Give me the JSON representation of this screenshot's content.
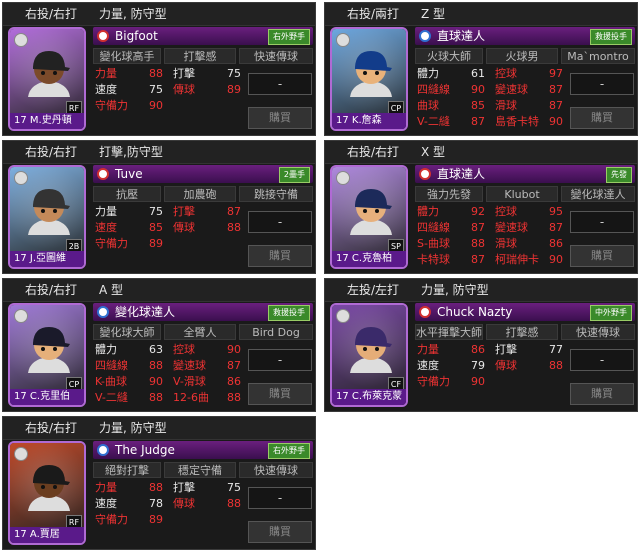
{
  "colors": {
    "stat_red": "#ee3333",
    "stat_white": "#e8e8e8",
    "skill_bar": "#6a1f7e",
    "portrait_border": "#b06ad4"
  },
  "cards": [
    {
      "hand": "右投/右打",
      "ptype": "力量, 防守型",
      "skill_icon": "red-circle-skill-icon",
      "skill_name": "Bigfoot",
      "role": "右外野手",
      "traits": [
        "變化球高手",
        "打擊感",
        "快速傳球"
      ],
      "stats": [
        [
          "力量",
          "88",
          "打擊",
          "75"
        ],
        [
          "速度",
          "75",
          "傳球",
          "89"
        ],
        [
          "守備力",
          "90",
          "",
          ""
        ]
      ],
      "stat_colors": [
        [
          "red",
          "red",
          "white",
          "white"
        ],
        [
          "white",
          "white",
          "red",
          "red"
        ],
        [
          "red",
          "red",
          "",
          ""
        ]
      ],
      "number_name": "17 M.史丹頓",
      "position": "RF",
      "select": "-",
      "buy": "購買",
      "portrait_color": "#b26edb",
      "cap": "#222",
      "face": "#7b4a2a"
    },
    {
      "hand": "右投/兩打",
      "ptype": "Z 型",
      "skill_icon": "blue-circle-skill-icon",
      "skill_name": "直球達人",
      "role": "救援投手",
      "traits": [
        "火球大師",
        "火球男",
        "Ma`montro"
      ],
      "stats": [
        [
          "體力",
          "61",
          "控球",
          "97"
        ],
        [
          "四縫線",
          "90",
          "變速球",
          "87"
        ],
        [
          "曲球",
          "85",
          "滑球",
          "87"
        ],
        [
          "V-二縫",
          "87",
          "島香卡特",
          "90"
        ]
      ],
      "stat_colors": [
        [
          "white",
          "white",
          "red",
          "red"
        ],
        [
          "red",
          "red",
          "red",
          "red"
        ],
        [
          "red",
          "red",
          "red",
          "red"
        ],
        [
          "red",
          "red",
          "red",
          "red"
        ]
      ],
      "number_name": "17 K.詹森",
      "position": "CP",
      "select": "-",
      "buy": "購買",
      "portrait_color": "#6ea8e0",
      "cap": "#123c8a",
      "face": "#e9b27a"
    },
    {
      "hand": "右投/右打",
      "ptype": "打擊,防守型",
      "skill_icon": "red-circle-skill-icon",
      "skill_name": "Tuve",
      "role": "2壘手",
      "traits": [
        "抗壓",
        "加農砲",
        "跳接守備"
      ],
      "stats": [
        [
          "力量",
          "75",
          "打擊",
          "87"
        ],
        [
          "速度",
          "85",
          "傳球",
          "88"
        ],
        [
          "守備力",
          "89",
          "",
          ""
        ]
      ],
      "stat_colors": [
        [
          "white",
          "white",
          "red",
          "red"
        ],
        [
          "red",
          "red",
          "red",
          "red"
        ],
        [
          "red",
          "red",
          "",
          ""
        ]
      ],
      "number_name": "17 J.亞圖維",
      "position": "2B",
      "select": "-",
      "buy": "購買",
      "portrait_color": "#7fb0e0",
      "cap": "#333",
      "face": "#c48a5a"
    },
    {
      "hand": "右投/右打",
      "ptype": "X 型",
      "skill_icon": "red-circle-skill-icon",
      "skill_name": "直球達人",
      "role": "先發",
      "traits": [
        "強力先發",
        "Klubot",
        "變化球達人"
      ],
      "stats": [
        [
          "體力",
          "92",
          "控球",
          "95"
        ],
        [
          "四縫線",
          "87",
          "變速球",
          "87"
        ],
        [
          "S-曲球",
          "88",
          "滑球",
          "86"
        ],
        [
          "卡特球",
          "87",
          "柯瑞伸卡",
          "90"
        ]
      ],
      "stat_colors": [
        [
          "red",
          "red",
          "red",
          "red"
        ],
        [
          "red",
          "red",
          "red",
          "red"
        ],
        [
          "red",
          "red",
          "red",
          "red"
        ],
        [
          "red",
          "red",
          "red",
          "red"
        ]
      ],
      "number_name": "17 C.克魯柏",
      "position": "SP",
      "select": "-",
      "buy": "購買",
      "portrait_color": "#b08adf",
      "cap": "#1c2a5a",
      "face": "#e7b07c"
    },
    {
      "hand": "右投/右打",
      "ptype": "A 型",
      "skill_icon": "blue-circle-skill-icon",
      "skill_name": "變化球達人",
      "role": "救援投手",
      "traits": [
        "變化球大師",
        "全臂人",
        "Bird Dog"
      ],
      "stats": [
        [
          "體力",
          "63",
          "控球",
          "90"
        ],
        [
          "四縫線",
          "88",
          "變速球",
          "87"
        ],
        [
          "K-曲球",
          "90",
          "V-滑球",
          "86"
        ],
        [
          "V-二縫",
          "88",
          "12-6曲",
          "88"
        ]
      ],
      "stat_colors": [
        [
          "white",
          "white",
          "red",
          "red"
        ],
        [
          "red",
          "red",
          "red",
          "red"
        ],
        [
          "red",
          "red",
          "red",
          "red"
        ],
        [
          "red",
          "red",
          "red",
          "red"
        ]
      ],
      "number_name": "17 C.克里伯",
      "position": "CP",
      "select": "-",
      "buy": "購買",
      "portrait_color": "#a07ad8",
      "cap": "#1a1a2a",
      "face": "#e6b07a"
    },
    {
      "hand": "左投/左打",
      "ptype": "力量, 防守型",
      "skill_icon": "red-circle-skill-icon",
      "skill_name": "Chuck Nazty",
      "role": "中外野手",
      "traits": [
        "水平揮擊大師",
        "打擊感",
        "快速傳球"
      ],
      "stats": [
        [
          "力量",
          "86",
          "打擊",
          "77"
        ],
        [
          "速度",
          "79",
          "傳球",
          "88"
        ],
        [
          "守備力",
          "90",
          "",
          ""
        ]
      ],
      "stat_colors": [
        [
          "red",
          "red",
          "white",
          "white"
        ],
        [
          "white",
          "white",
          "red",
          "red"
        ],
        [
          "red",
          "red",
          "",
          ""
        ]
      ],
      "number_name": "17 C.布萊克蒙",
      "position": "CF",
      "select": "-",
      "buy": "購買",
      "portrait_color": "#7c4aa8",
      "cap": "#3a2a6a",
      "face": "#e5ad78"
    },
    {
      "hand": "右投/右打",
      "ptype": "力量, 防守型",
      "skill_icon": "blue-circle-skill-icon",
      "skill_name": "The Judge",
      "role": "右外野手",
      "traits": [
        "絕對打擊",
        "穩定守備",
        "快速傳球"
      ],
      "stats": [
        [
          "力量",
          "88",
          "打擊",
          "75"
        ],
        [
          "速度",
          "78",
          "傳球",
          "88"
        ],
        [
          "守備力",
          "89",
          "",
          ""
        ]
      ],
      "stat_colors": [
        [
          "red",
          "red",
          "white",
          "white"
        ],
        [
          "white",
          "white",
          "red",
          "red"
        ],
        [
          "red",
          "red",
          "",
          ""
        ]
      ],
      "number_name": "17 A.賈居",
      "position": "RF",
      "select": "-",
      "buy": "購買",
      "portrait_color": "#c04a2a",
      "cap": "#1a1a1a",
      "face": "#6b3e20"
    }
  ]
}
